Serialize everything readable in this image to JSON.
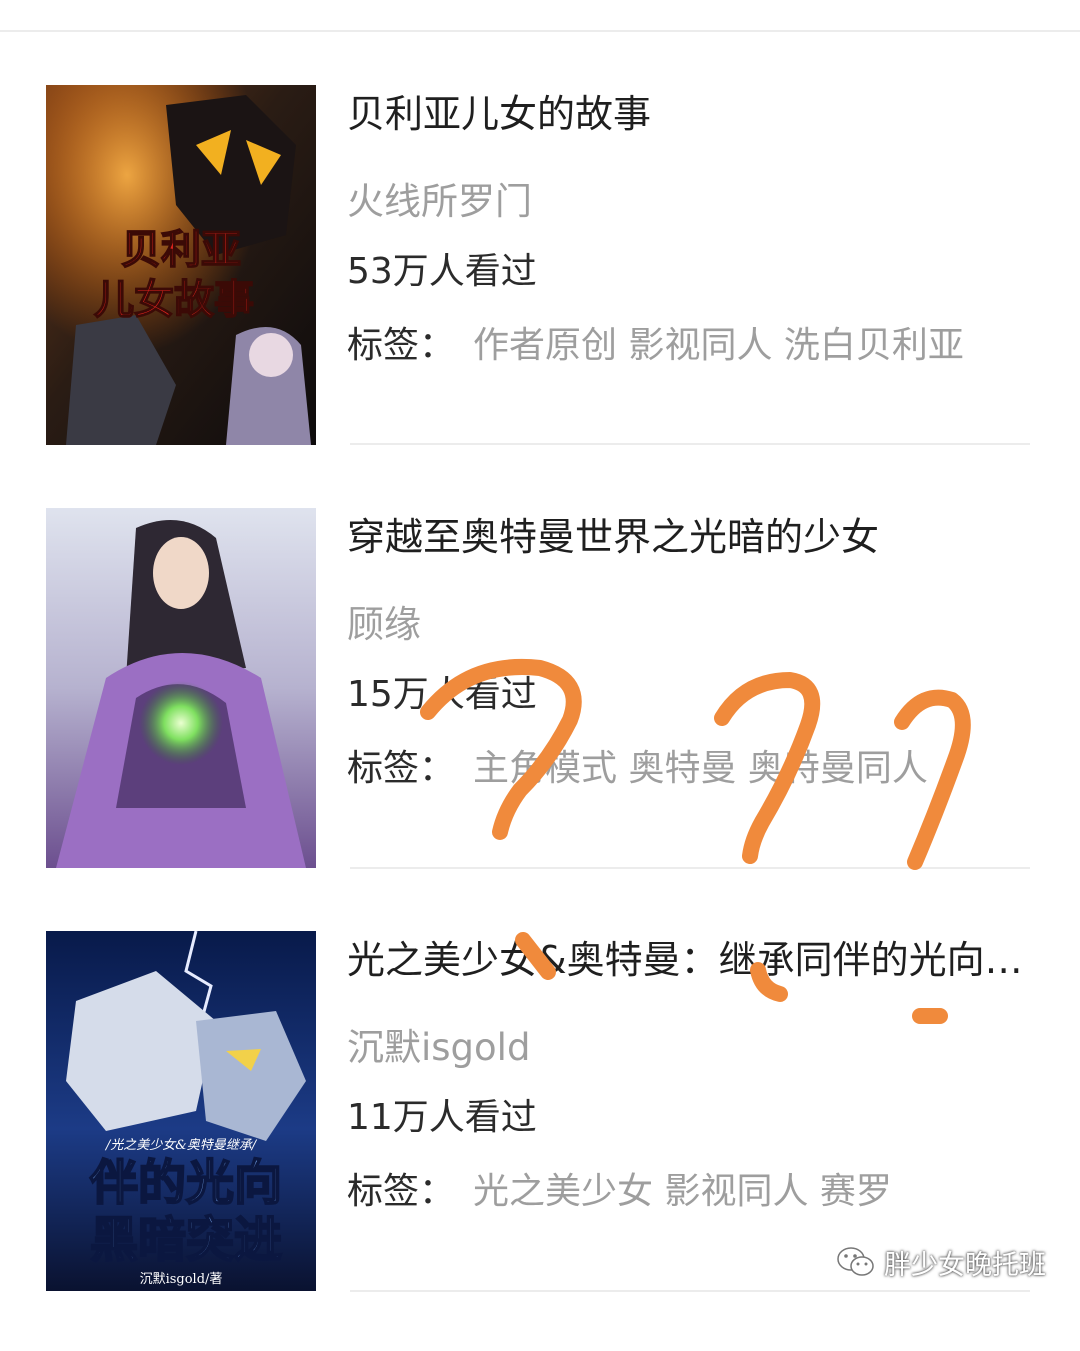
{
  "books": [
    {
      "title": "贝利亚儿女的故事",
      "author": "火线所罗门",
      "views": "53万人看过",
      "tags_label": "标签：",
      "tags": "作者原创 影视同人 洗白贝利亚",
      "cover_text": [
        "贝利亚",
        "儿女故事"
      ]
    },
    {
      "title": "穿越至奥特曼世界之光暗的少女",
      "author": "顾缘",
      "views": "15万人看过",
      "tags_label": "标签：",
      "tags": "主角模式 奥特曼 奥特曼同人"
    },
    {
      "title": "光之美少女&奥特曼：继承同伴的光向黑暗突进",
      "author": "沉默isgold",
      "views": "11万人看过",
      "tags_label": "标签：",
      "tags": "光之美少女 影视同人 赛罗",
      "cover_text": [
        "/光之美少女&奥特曼继承/",
        "伴的光向",
        "黑暗突进",
        "沉默isgold/著"
      ]
    }
  ],
  "watermark": {
    "text": "胖少女晚托班",
    "icon": "wechat-icon"
  },
  "colors": {
    "title": "#1f1f1f",
    "muted": "#9e9e9e",
    "annotation": "#f08a3c"
  }
}
